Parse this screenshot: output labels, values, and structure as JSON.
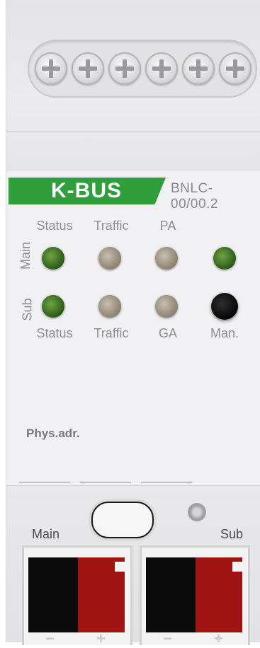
{
  "brand": "K-BUS",
  "model": "BNLC-00/00.2",
  "rows": {
    "main": "Main",
    "sub": "Sub"
  },
  "main_leds": [
    "Status",
    "Traffic",
    "PA"
  ],
  "sub_leds": [
    "Status",
    "Traffic",
    "GA",
    "Man."
  ],
  "phys_label": "Phys.adr.",
  "terminals": {
    "main": "Main",
    "sub": "Sub",
    "minus": "−",
    "plus": "+"
  },
  "colors": {
    "brand_green": "#2f9e3b",
    "led_green": "#2c5a17",
    "led_amber": "#8d8170",
    "terminal_red": "#a11414"
  }
}
